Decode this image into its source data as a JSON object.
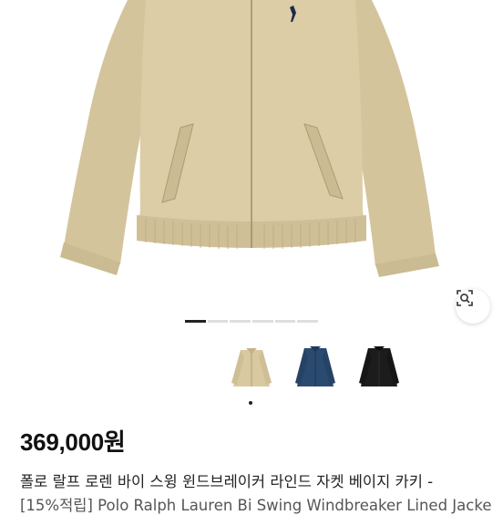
{
  "product": {
    "image_alt": "Beige windbreaker jacket",
    "color_swatches": [
      {
        "name": "beige",
        "color": "#d8c9a0"
      },
      {
        "name": "navy",
        "color": "#2b4a70"
      },
      {
        "name": "black",
        "color": "#1c1c1c"
      }
    ],
    "selected_swatch": 0,
    "gallery_page_count": 6,
    "gallery_active_index": 0,
    "price": "369,000원",
    "title_korean": "폴로 랄프 로렌 바이 스윙 윈드브레이커 라인드 자켓 베이지 카키 -",
    "title_english": "[15%적립] Polo Ralph Lauren Bi Swing Windbreaker Lined Jacke"
  },
  "icons": {
    "lens": "image-search-icon"
  },
  "colors": {
    "jacket": "#dccda6",
    "indicator_active": "#222222",
    "indicator_inactive": "#dedede"
  }
}
